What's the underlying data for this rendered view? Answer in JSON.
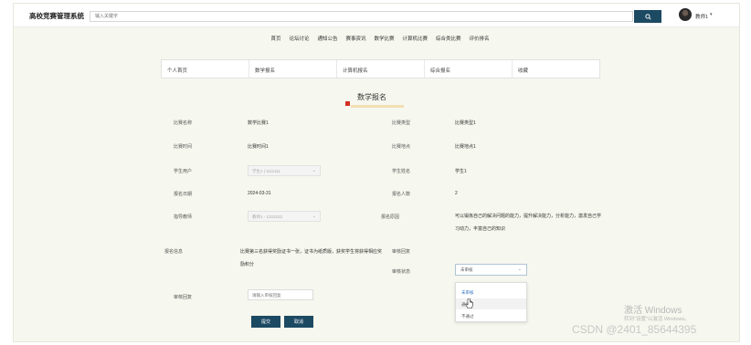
{
  "header": {
    "site_title": "高校竞赛管理系统",
    "search_placeholder": "输入关键字",
    "user_name": "教师1",
    "user_caret": "▾"
  },
  "main_nav": [
    "首页",
    "论坛讨论",
    "通知公告",
    "赛事资讯",
    "数学比赛",
    "计算机比赛",
    "综合类比赛",
    "评价排名"
  ],
  "sub_tabs": [
    "个人首页",
    "数学报名",
    "计算机报名",
    "综合报名",
    "收藏"
  ],
  "page": {
    "title": "数学报名"
  },
  "form": {
    "competition_name": {
      "label": "比赛名称",
      "value": "数学比赛1"
    },
    "competition_type": {
      "label": "比赛类型",
      "value": "比赛类型1"
    },
    "competition_time": {
      "label": "比赛时间",
      "value": "比赛时间1"
    },
    "competition_location": {
      "label": "比赛地点",
      "value": "比赛地点1"
    },
    "student_account": {
      "label": "学生用户",
      "value": "学生1 | 1111111"
    },
    "student_name": {
      "label": "学生姓名",
      "value": "学生1"
    },
    "signup_date": {
      "label": "报名日期",
      "value": "2024-03-31"
    },
    "signup_count": {
      "label": "报名人数",
      "value": "2"
    },
    "advisor": {
      "label": "指导教师",
      "value": "教师1 - 1222222"
    },
    "signup_reason": {
      "label": "报名原因",
      "line1": "可以锻炼自己的解决问题的能力，提升解决能力，分析能力，激发自己学",
      "line2": "习动力，丰富自己的知识"
    },
    "signup_info": {
      "label": "报名信息",
      "line1": "比赛第三名获得奖励证书一张，证书为纸质版，获奖学生将获得相应奖",
      "line2": "励积分"
    },
    "review_reply": {
      "label": "审核回复",
      "value": ""
    },
    "review_status": {
      "label": "审核状态",
      "current": "未审核",
      "chevron": "⌄"
    },
    "status_options": [
      "未审核",
      "通过",
      "不通过"
    ],
    "review_remark": {
      "label": "审核回复",
      "placeholder": "请输入审核回复"
    }
  },
  "buttons": {
    "submit": "提交",
    "cancel": "取消"
  },
  "watermarks": {
    "activate_title": "激活 Windows",
    "activate_sub": "转到\"设置\"以激活 Windows。",
    "csdn": "CSDN @2401_85644395"
  }
}
